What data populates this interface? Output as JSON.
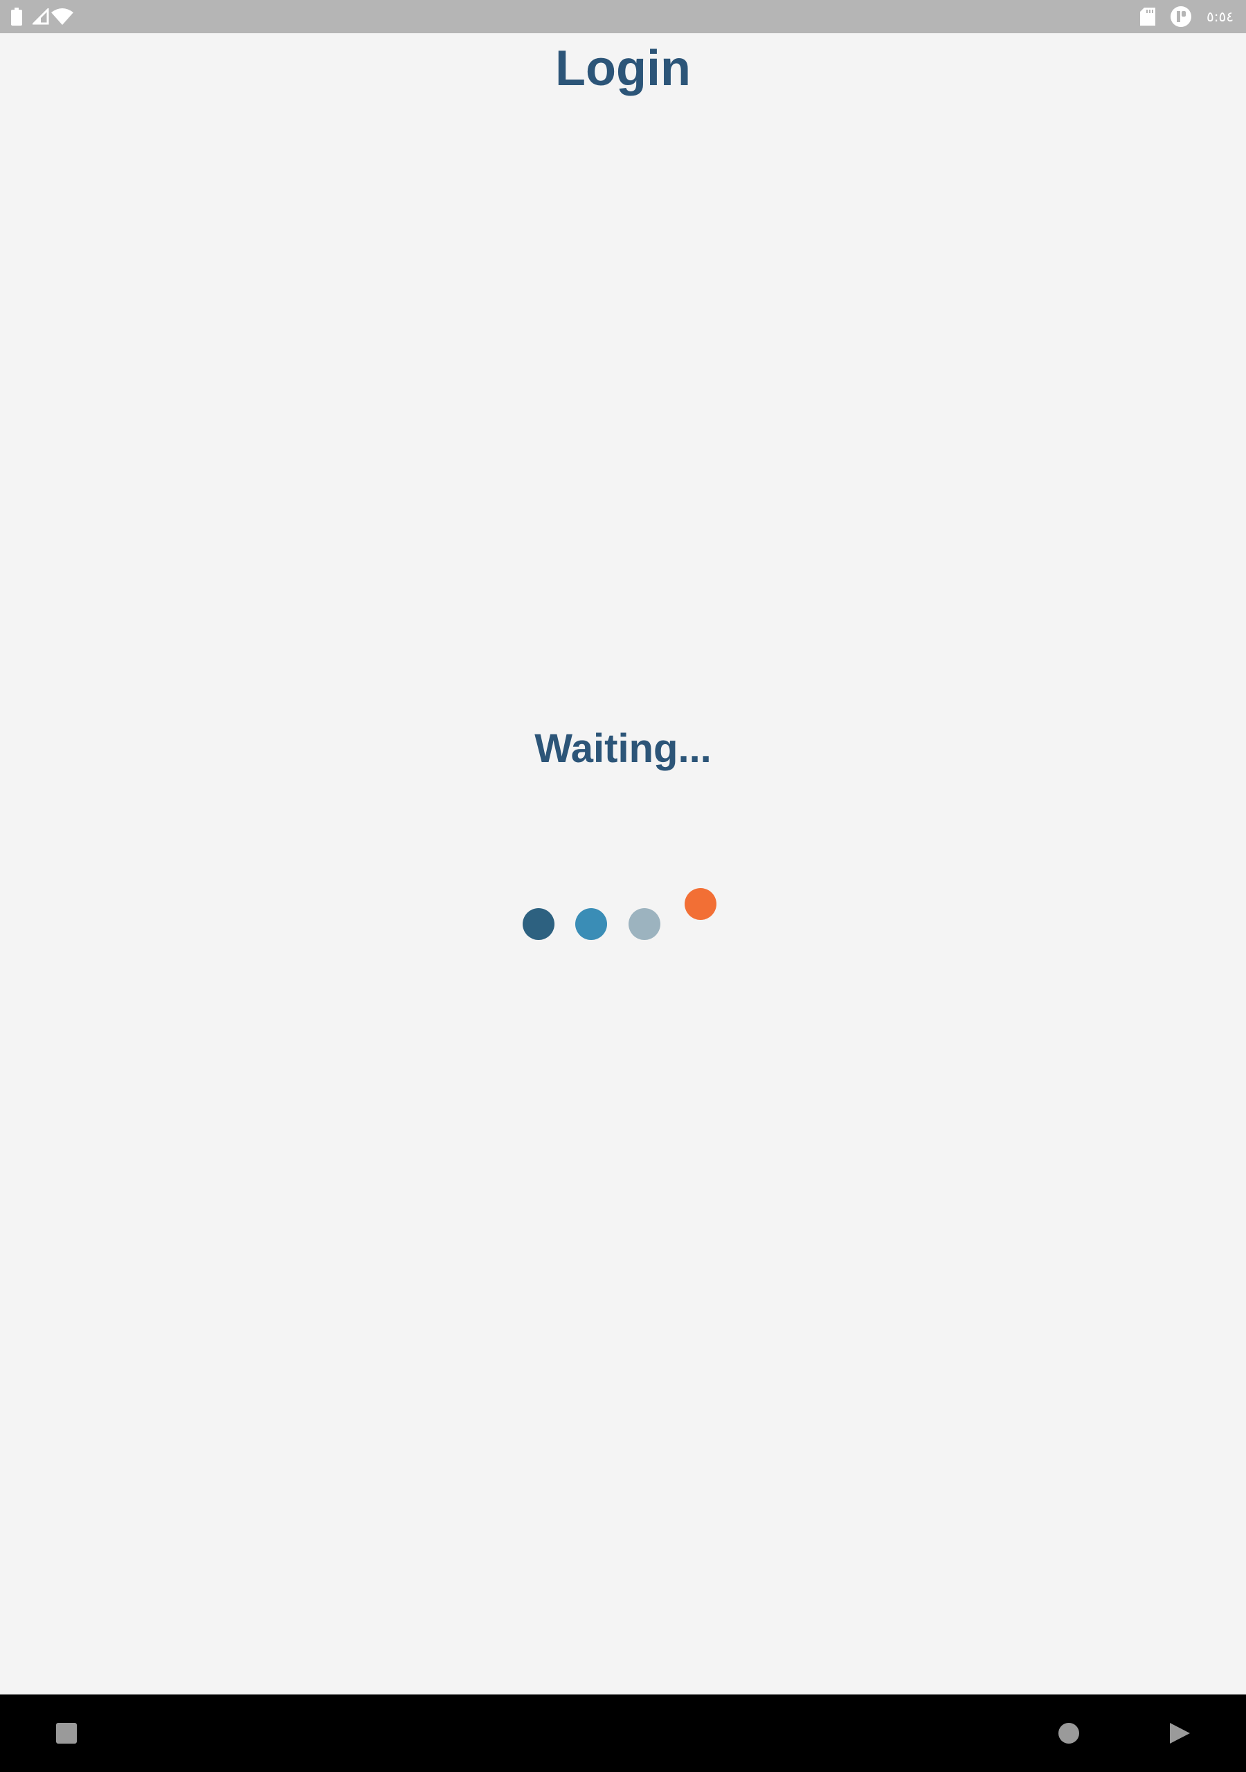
{
  "status_bar": {
    "time": "٥:٥٤",
    "left_icons": [
      "battery-icon",
      "signal-icon",
      "wifi-icon"
    ],
    "right_icons": [
      "sd-card-icon",
      "app-notification-icon"
    ],
    "background": "#b5b5b5"
  },
  "page": {
    "title": "Login",
    "waiting_text": "Waiting...",
    "accent_color": "#2c5578",
    "background": "#f4f4f4"
  },
  "loader": {
    "dots": [
      {
        "name": "loader-dot-1",
        "color": "#2d6180"
      },
      {
        "name": "loader-dot-2",
        "color": "#3a8db6"
      },
      {
        "name": "loader-dot-3",
        "color": "#9cb3bf"
      },
      {
        "name": "loader-dot-4",
        "color": "#f26f35"
      }
    ]
  },
  "nav_bar": {
    "buttons": [
      "recents-button",
      "home-button",
      "back-button"
    ],
    "background": "#000000"
  }
}
